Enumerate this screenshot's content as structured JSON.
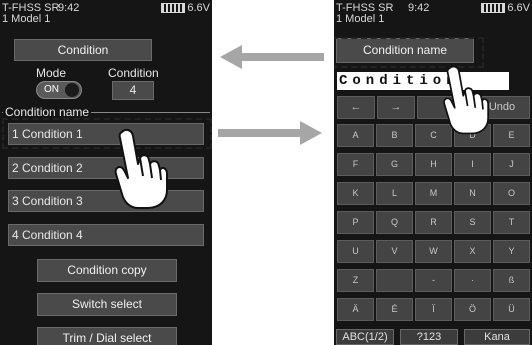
{
  "left_screen": {
    "status": {
      "system": "T-FHSS SR",
      "time": "9:42",
      "voltage": "6.6V",
      "model": "1   Model 1"
    },
    "title_button": "Condition",
    "mode_label": "Mode",
    "mode_toggle": "ON",
    "condition_label": "Condition",
    "condition_value": "4",
    "group_label": "Condition name",
    "conditions": [
      "1 Condition 1",
      "2 Condition 2",
      "3 Condition 3",
      "4 Condition 4"
    ],
    "actions": [
      "Condition copy",
      "Switch select",
      "Trim / Dial select"
    ]
  },
  "right_screen": {
    "status": {
      "system": "T-FHSS SR",
      "time": "9:42",
      "voltage": "6.6V",
      "model": "1   Model 1"
    },
    "title_button": "Condition name",
    "text_value": "Condition",
    "nav_keys": [
      "←",
      "→",
      "",
      "Undo"
    ],
    "keys": [
      [
        "A",
        "B",
        "C",
        "D",
        "E"
      ],
      [
        "F",
        "G",
        "H",
        "I",
        "J"
      ],
      [
        "K",
        "L",
        "M",
        "N",
        "O"
      ],
      [
        "P",
        "Q",
        "R",
        "S",
        "T"
      ],
      [
        "U",
        "V",
        "W",
        "X",
        "Y"
      ],
      [
        "Z",
        "",
        "-",
        "·",
        "ß"
      ],
      [
        "Ä",
        "É",
        "Ï",
        "Ö",
        "Ü"
      ]
    ],
    "bottom_buttons": [
      "ABC(1/2)",
      "?123",
      "Kana"
    ]
  },
  "colors": {
    "screen_bg": "#151515",
    "button": "#4a4a4a",
    "arrow": "#a6a6a6"
  },
  "icons": {
    "arrow_left": "arrow-left-icon",
    "arrow_right": "arrow-right-icon",
    "hand": "hand-pointer-icon"
  }
}
